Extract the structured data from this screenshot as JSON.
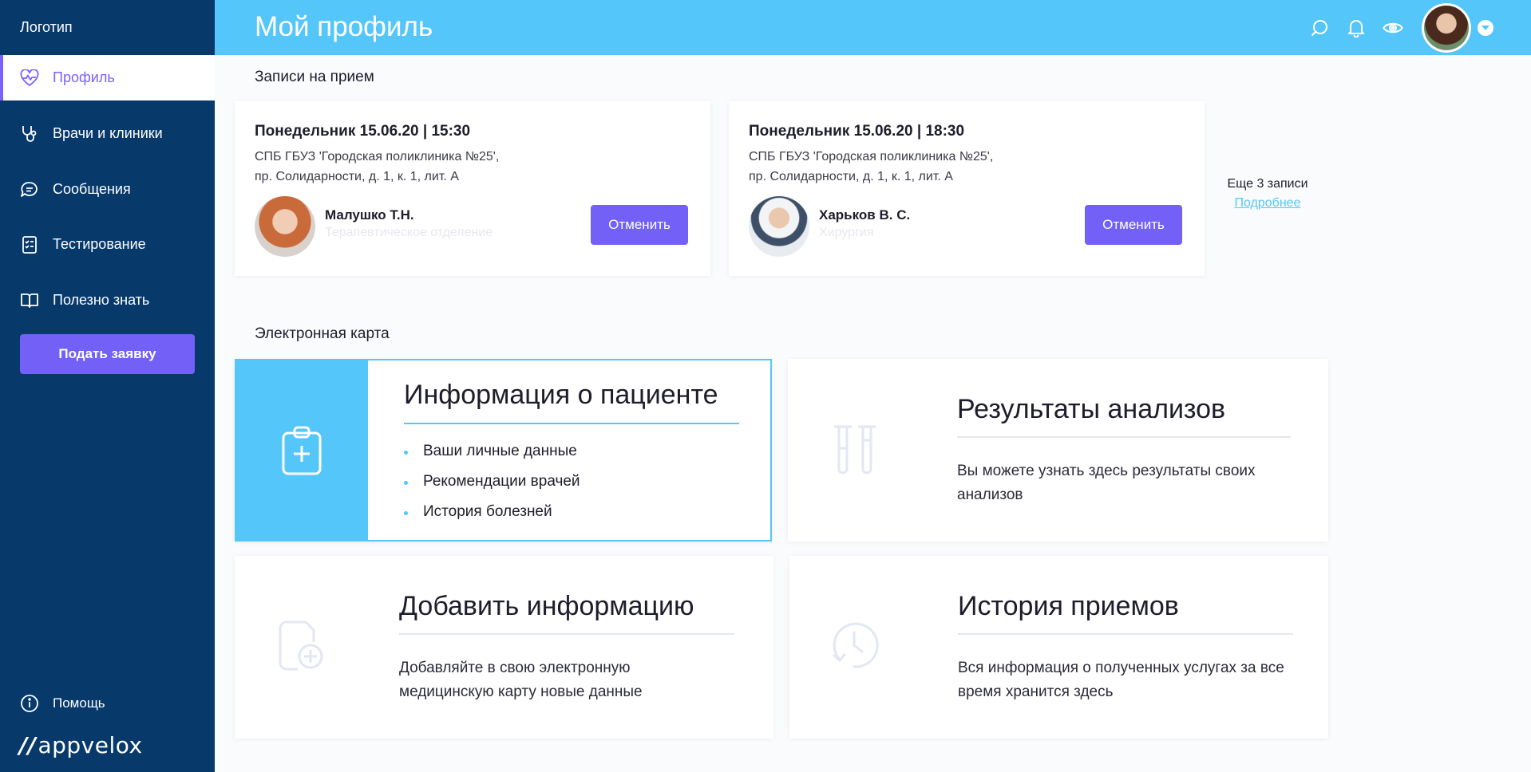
{
  "sidebar": {
    "logo": "Логотип",
    "items": [
      {
        "label": "Профиль",
        "icon": "heart-pulse-icon"
      },
      {
        "label": "Врачи и клиники",
        "icon": "stethoscope-icon"
      },
      {
        "label": "Сообщения",
        "icon": "chat-icon"
      },
      {
        "label": "Тестирование",
        "icon": "checklist-icon"
      },
      {
        "label": "Полезно знать",
        "icon": "book-icon"
      }
    ],
    "apply_button": "Подать заявку",
    "help": "Помощь",
    "brand": "appvelox"
  },
  "header": {
    "title": "Мой профиль",
    "icons": [
      "search-icon",
      "bell-icon",
      "eye-icon"
    ]
  },
  "appointments": {
    "title": "Записи на прием",
    "items": [
      {
        "when": "Понедельник 15.06.20 | 15:30",
        "clinic_line1": "СПБ ГБУЗ 'Городская поликлиника №25',",
        "clinic_line2": "пр. Солидарности, д. 1, к. 1, лит. А",
        "doctor": "Малушко Т.Н.",
        "department": "Терапевтическое отделение",
        "cancel": "Отменить"
      },
      {
        "when": "Понедельник 15.06.20 | 18:30",
        "clinic_line1": "СПБ ГБУЗ 'Городская поликлиника №25',",
        "clinic_line2": "пр. Солидарности, д. 1, к. 1, лит. А",
        "doctor": "Харьков В. С.",
        "department": "Хирургия",
        "cancel": "Отменить"
      }
    ],
    "more_count": "Еще 3 записи",
    "more_link": "Подробнее"
  },
  "ecard": {
    "title": "Электронная карта",
    "patient_info": {
      "title": "Информация о пациенте",
      "bullets": [
        "Ваши личные данные",
        "Рекомендации врачей",
        "История болезней"
      ]
    },
    "results": {
      "title": "Результаты анализов",
      "desc": "Вы можете узнать здесь результаты своих анализов"
    },
    "add_info": {
      "title": "Добавить информацию",
      "desc": "Добавляйте в свою электронную медицинскую карту новые данные"
    },
    "history": {
      "title": "История приемов",
      "desc": "Вся информация о полученных услугах за все время хранится здесь"
    }
  },
  "colors": {
    "sidebar": "#07396b",
    "header": "#55c6fa",
    "accent": "#7260f7"
  }
}
